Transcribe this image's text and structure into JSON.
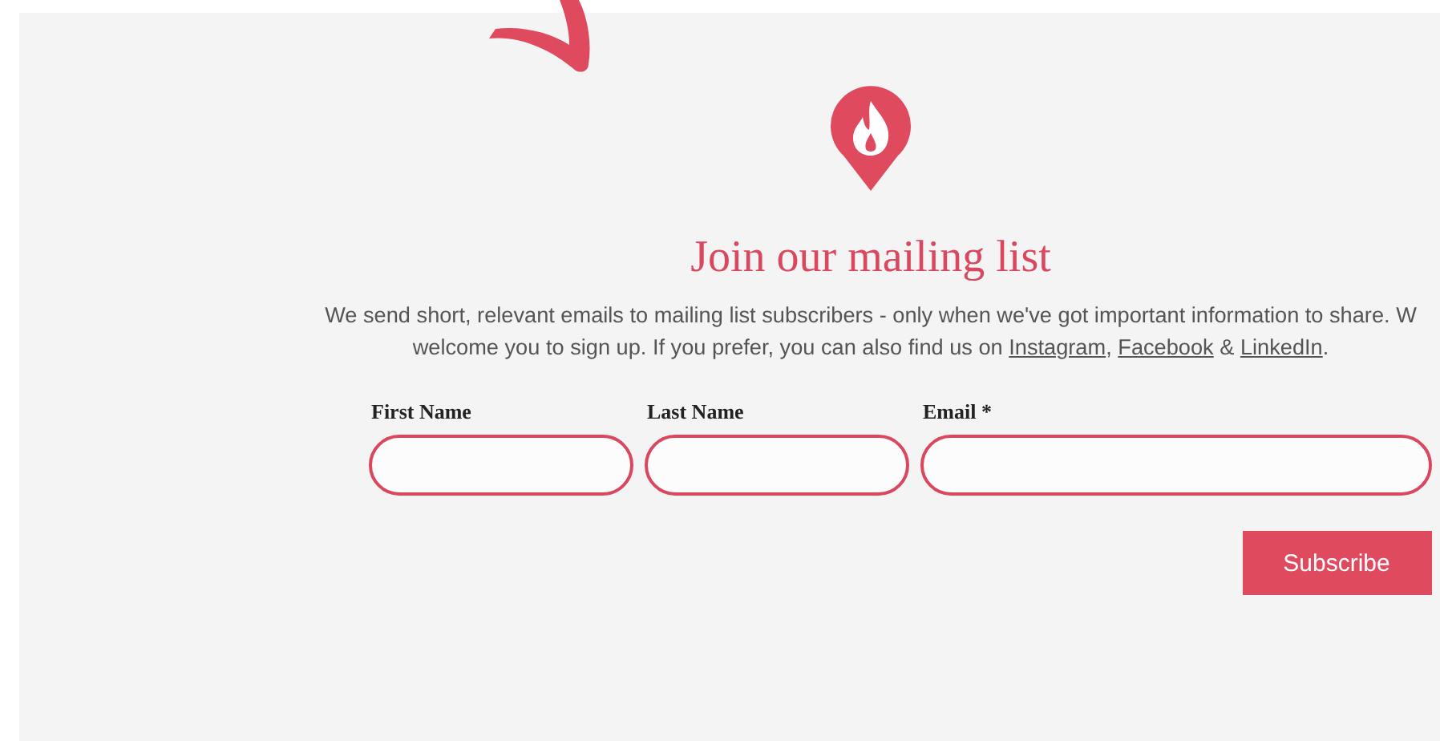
{
  "heading": "Join our mailing list",
  "intro": {
    "line_1": "We send short, relevant emails to mailing list subscribers - only when we've got important information to share. W",
    "line_2": "welcome you to sign up. If you prefer, you can also find us on",
    "links": [
      {
        "label": "Instagram",
        "after": ","
      },
      {
        "label": "Facebook",
        "after": " &"
      },
      {
        "label": "LinkedIn",
        "after": "."
      }
    ]
  },
  "fields": [
    {
      "label": "First Name",
      "kind": "short"
    },
    {
      "label": "Last Name",
      "kind": "short"
    },
    {
      "label": "Email *",
      "kind": "wide"
    }
  ],
  "submit": "Subscribe"
}
